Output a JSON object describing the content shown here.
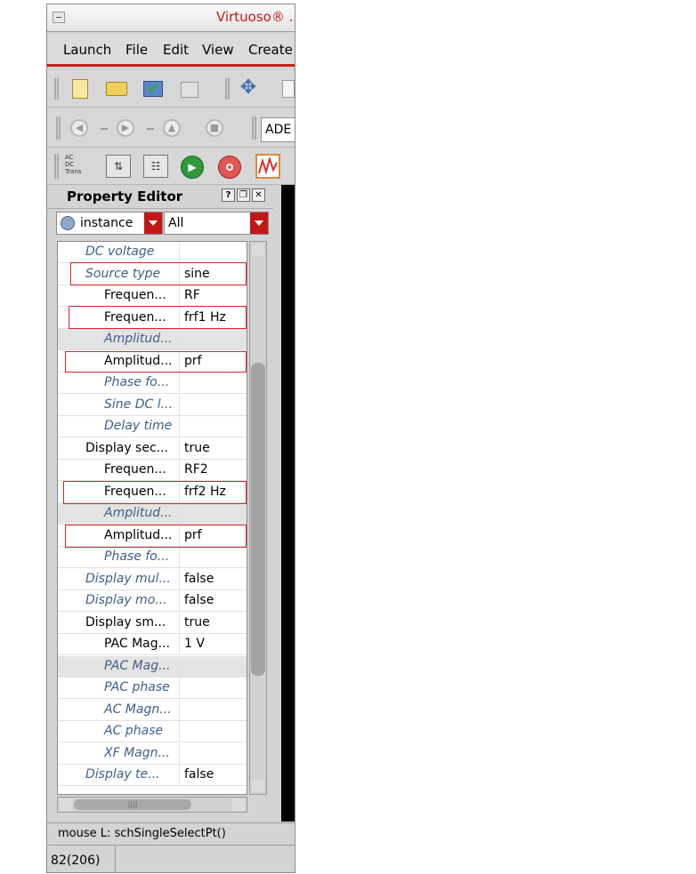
{
  "window": {
    "title": "Virtuoso® ..."
  },
  "menu": {
    "items": [
      "Launch",
      "File",
      "Edit",
      "View",
      "Create"
    ]
  },
  "toolbar": {
    "ade_field": "ADE L"
  },
  "simulation_toolbar": {
    "analysis_labels": [
      "AC",
      "DC",
      "Trans"
    ]
  },
  "property_editor": {
    "title": "Property Editor",
    "object_type": "instance",
    "filter": "All",
    "rows": [
      {
        "name": "DC voltage",
        "value": "",
        "italic": true,
        "indent": 0
      },
      {
        "name": "Source type",
        "value": "sine",
        "italic": true,
        "indent": 0
      },
      {
        "name": "Frequen...",
        "value": "RF",
        "italic": false,
        "indent": 1
      },
      {
        "name": "Frequen...",
        "value": "frf1 Hz",
        "italic": false,
        "indent": 1
      },
      {
        "name": "Amplitud...",
        "value": "",
        "italic": true,
        "indent": 1,
        "gray": true
      },
      {
        "name": "Amplitud...",
        "value": "prf",
        "italic": false,
        "indent": 1
      },
      {
        "name": "Phase fo...",
        "value": "",
        "italic": true,
        "indent": 1
      },
      {
        "name": "Sine DC l...",
        "value": "",
        "italic": true,
        "indent": 1
      },
      {
        "name": "Delay time",
        "value": "",
        "italic": true,
        "indent": 1
      },
      {
        "name": "Display sec...",
        "value": "true",
        "italic": false,
        "indent": 0
      },
      {
        "name": "Frequen...",
        "value": "RF2",
        "italic": false,
        "indent": 1
      },
      {
        "name": "Frequen...",
        "value": "frf2 Hz",
        "italic": false,
        "indent": 1
      },
      {
        "name": "Amplitud...",
        "value": "",
        "italic": true,
        "indent": 1,
        "gray": true
      },
      {
        "name": "Amplitud...",
        "value": "prf",
        "italic": false,
        "indent": 1
      },
      {
        "name": "Phase fo...",
        "value": "",
        "italic": true,
        "indent": 1
      },
      {
        "name": "Display mul...",
        "value": "false",
        "italic": true,
        "indent": 0
      },
      {
        "name": "Display mo...",
        "value": "false",
        "italic": true,
        "indent": 0
      },
      {
        "name": "Display sm...",
        "value": "true",
        "italic": false,
        "indent": 0
      },
      {
        "name": "PAC Mag...",
        "value": "1 V",
        "italic": false,
        "indent": 1
      },
      {
        "name": "PAC Mag...",
        "value": "",
        "italic": true,
        "indent": 1,
        "gray": true
      },
      {
        "name": "PAC phase",
        "value": "",
        "italic": true,
        "indent": 1
      },
      {
        "name": "AC Magn...",
        "value": "",
        "italic": true,
        "indent": 1
      },
      {
        "name": "AC phase",
        "value": "",
        "italic": true,
        "indent": 1
      },
      {
        "name": "XF Magn...",
        "value": "",
        "italic": true,
        "indent": 1
      },
      {
        "name": "Display te...",
        "value": "false",
        "italic": true,
        "indent": 0
      }
    ]
  },
  "status": {
    "mouse": "mouse L: schSingleSelectPt()",
    "count": "82(206)"
  },
  "colors": {
    "accent_red": "#c21f1f",
    "highlight_red": "#d8222a",
    "italic_text": "#3f5f88"
  }
}
